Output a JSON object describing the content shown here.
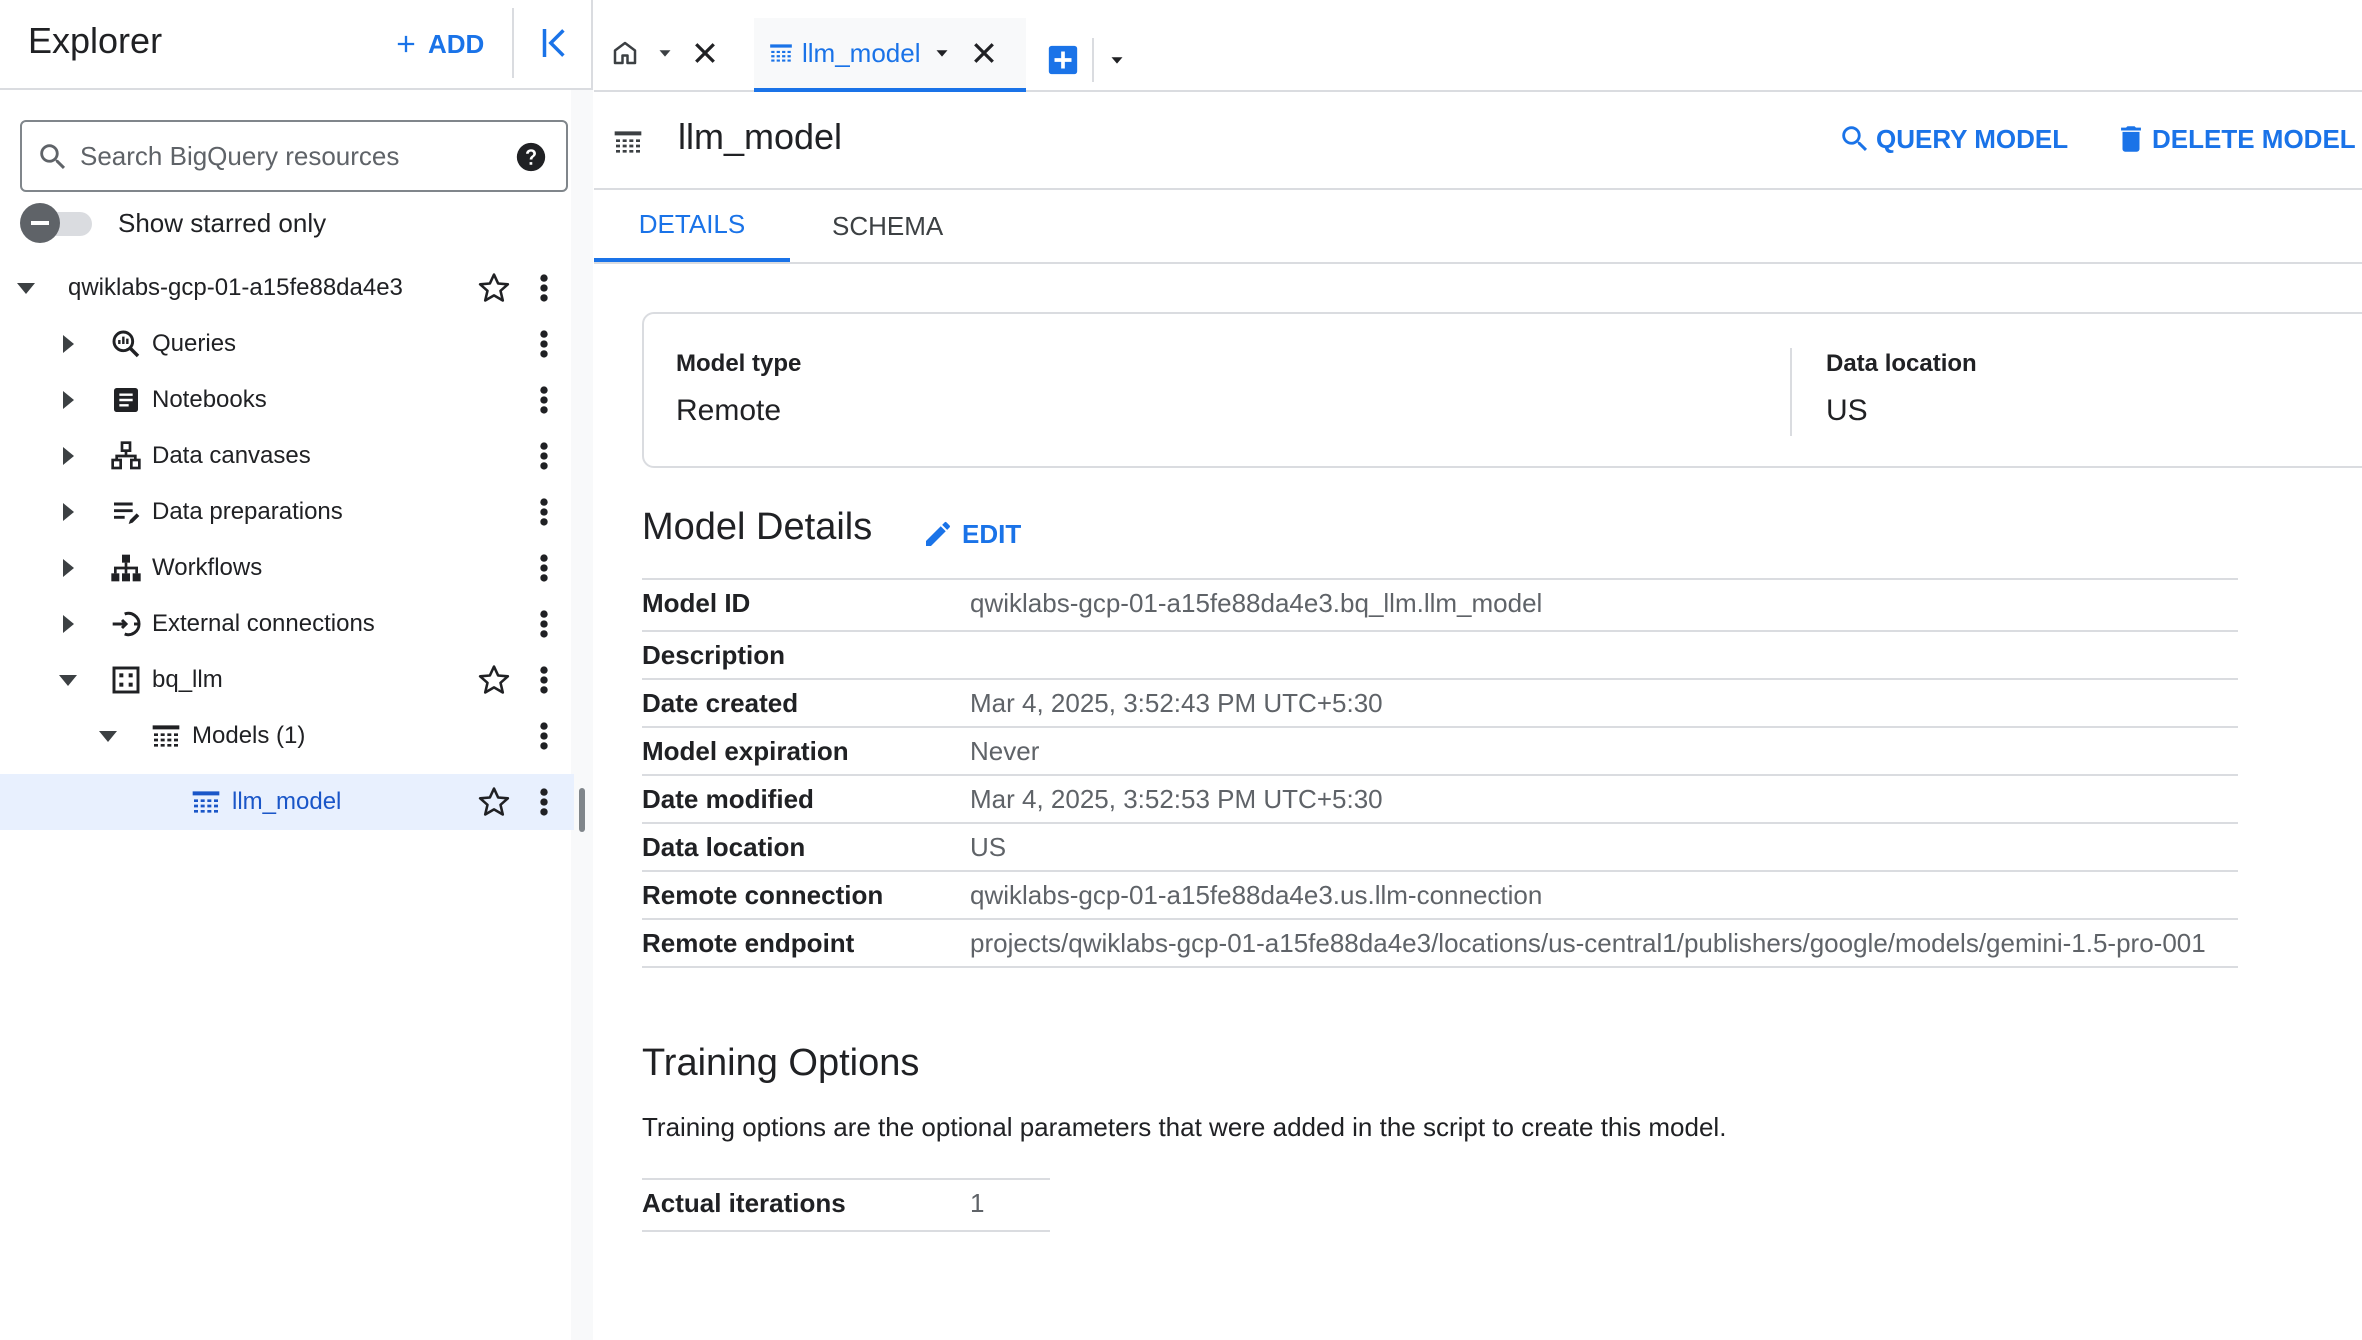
{
  "explorer": {
    "title": "Explorer",
    "add_label": "ADD",
    "search_placeholder": "Search BigQuery resources",
    "starred_label": "Show starred only",
    "project": "qwiklabs-gcp-01-a15fe88da4e3",
    "items": [
      {
        "label": "Queries",
        "icon": "queries-icon"
      },
      {
        "label": "Notebooks",
        "icon": "notebook-icon"
      },
      {
        "label": "Data canvases",
        "icon": "data-canvas-icon"
      },
      {
        "label": "Data preparations",
        "icon": "data-prep-icon"
      },
      {
        "label": "Workflows",
        "icon": "workflow-icon"
      },
      {
        "label": "External connections",
        "icon": "external-connection-icon"
      }
    ],
    "dataset": "bq_llm",
    "models_folder": "Models (1)",
    "model": "llm_model"
  },
  "tabs": {
    "active_label": "llm_model"
  },
  "header": {
    "title": "llm_model",
    "query_model_label": "QUERY MODEL",
    "delete_model_label": "DELETE MODEL"
  },
  "subtabs": {
    "details": "DETAILS",
    "schema": "SCHEMA"
  },
  "summary": {
    "model_type_label": "Model type",
    "model_type_value": "Remote",
    "data_location_label": "Data location",
    "data_location_value": "US"
  },
  "model_details": {
    "heading": "Model Details",
    "edit_label": "EDIT",
    "rows": [
      {
        "key": "Model ID",
        "value": "qwiklabs-gcp-01-a15fe88da4e3.bq_llm.llm_model"
      },
      {
        "key": "Description",
        "value": ""
      },
      {
        "key": "Date created",
        "value": "Mar 4, 2025, 3:52:43 PM UTC+5:30"
      },
      {
        "key": "Model expiration",
        "value": "Never"
      },
      {
        "key": "Date modified",
        "value": "Mar 4, 2025, 3:52:53 PM UTC+5:30"
      },
      {
        "key": "Data location",
        "value": "US"
      },
      {
        "key": "Remote connection",
        "value": "qwiklabs-gcp-01-a15fe88da4e3.us.llm-connection"
      },
      {
        "key": "Remote endpoint",
        "value": "projects/qwiklabs-gcp-01-a15fe88da4e3/locations/us-central1/publishers/google/models/gemini-1.5-pro-001"
      }
    ]
  },
  "training_options": {
    "heading": "Training Options",
    "description": "Training options are the optional parameters that were added in the script to create this model.",
    "rows": [
      {
        "key": "Actual iterations",
        "value": "1"
      }
    ]
  },
  "colors": {
    "accent": "#1a73e8",
    "selected_bg": "#e8f0fe",
    "text": "#202124",
    "muted": "#5f6368",
    "divider": "#dadce0"
  }
}
